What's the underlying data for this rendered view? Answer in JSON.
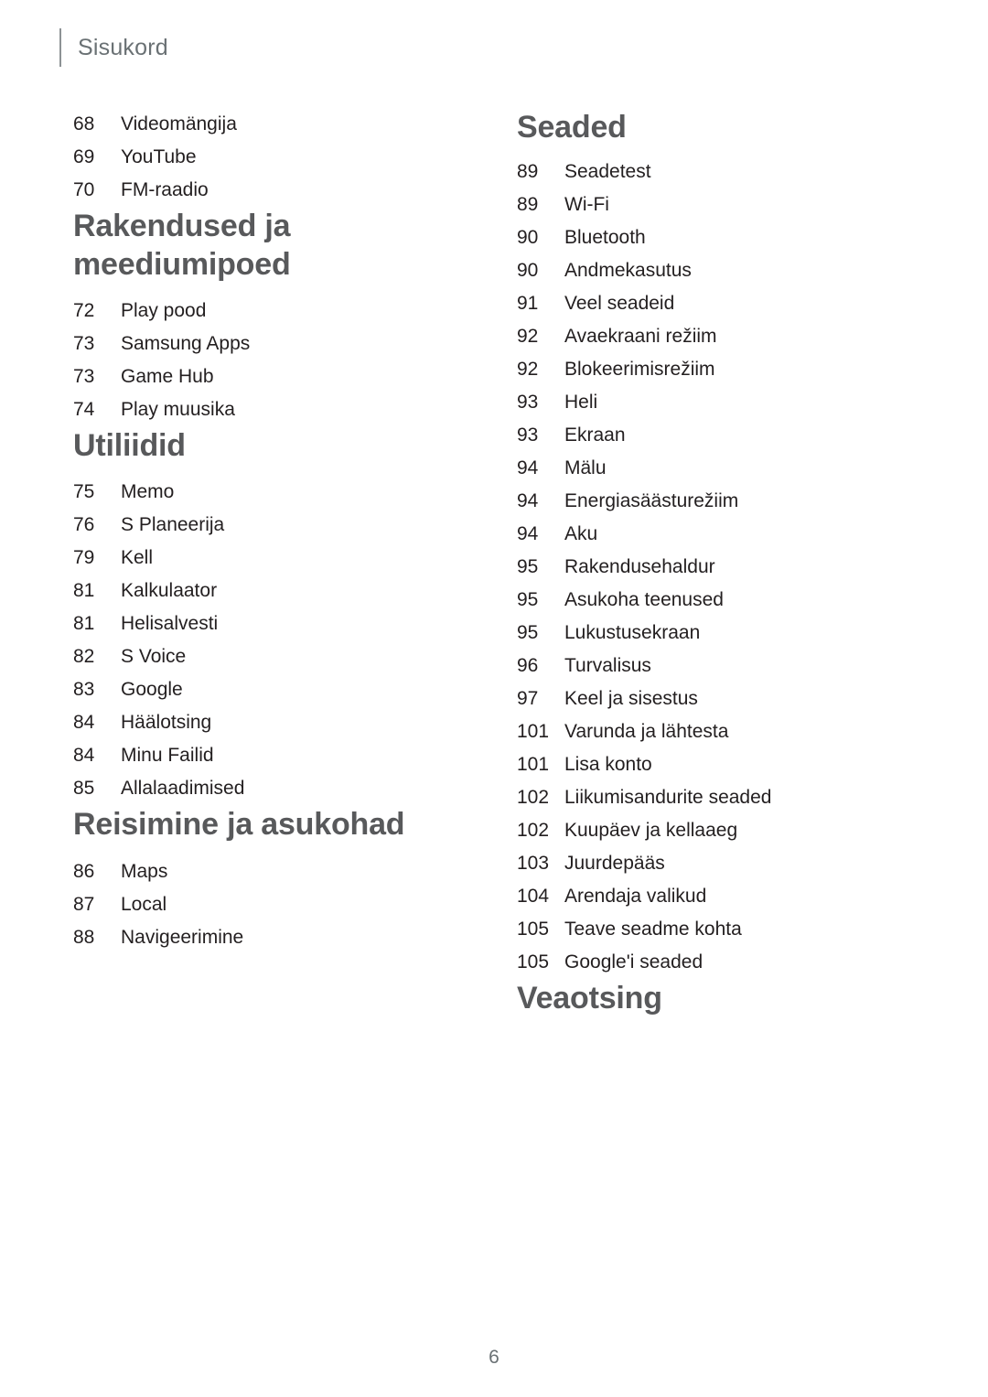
{
  "header": {
    "title": "Sisukord"
  },
  "folio": {
    "page_number": "6"
  },
  "colors": {
    "heading": "#58595b",
    "body_text": "#231f20",
    "running_header": "#6a7174",
    "rule": "#8d9295",
    "background": "#ffffff"
  },
  "left_column": {
    "sections": [
      {
        "heading": "",
        "entries": [
          {
            "page": "68",
            "label": "Videomängija"
          },
          {
            "page": "69",
            "label": "YouTube"
          },
          {
            "page": "70",
            "label": "FM-raadio"
          }
        ]
      },
      {
        "heading": "Rakendused ja\nmeediumipoed",
        "entries": [
          {
            "page": "72",
            "label": "Play pood"
          },
          {
            "page": "73",
            "label": "Samsung Apps"
          },
          {
            "page": "73",
            "label": "Game Hub"
          },
          {
            "page": "74",
            "label": "Play muusika"
          }
        ]
      },
      {
        "heading": "Utiliidid",
        "entries": [
          {
            "page": "75",
            "label": "Memo"
          },
          {
            "page": "76",
            "label": "S Planeerija"
          },
          {
            "page": "79",
            "label": "Kell"
          },
          {
            "page": "81",
            "label": "Kalkulaator"
          },
          {
            "page": "81",
            "label": "Helisalvesti"
          },
          {
            "page": "82",
            "label": "S Voice"
          },
          {
            "page": "83",
            "label": "Google"
          },
          {
            "page": "84",
            "label": "Häälotsing"
          },
          {
            "page": "84",
            "label": "Minu Failid"
          },
          {
            "page": "85",
            "label": "Allalaadimised"
          }
        ]
      },
      {
        "heading": "Reisimine ja asukohad",
        "entries": [
          {
            "page": "86",
            "label": "Maps"
          },
          {
            "page": "87",
            "label": "Local"
          },
          {
            "page": "88",
            "label": "Navigeerimine"
          }
        ]
      }
    ]
  },
  "right_column": {
    "sections": [
      {
        "heading": "Seaded",
        "entries": [
          {
            "page": "89",
            "label": "Seadetest"
          },
          {
            "page": "89",
            "label": "Wi-Fi"
          },
          {
            "page": "90",
            "label": "Bluetooth"
          },
          {
            "page": "90",
            "label": "Andmekasutus"
          },
          {
            "page": "91",
            "label": "Veel seadeid"
          },
          {
            "page": "92",
            "label": "Avaekraani režiim"
          },
          {
            "page": "92",
            "label": "Blokeerimisrežiim"
          },
          {
            "page": "93",
            "label": "Heli"
          },
          {
            "page": "93",
            "label": "Ekraan"
          },
          {
            "page": "94",
            "label": "Mälu"
          },
          {
            "page": "94",
            "label": "Energiasäästurežiim"
          },
          {
            "page": "94",
            "label": "Aku"
          },
          {
            "page": "95",
            "label": "Rakendusehaldur"
          },
          {
            "page": "95",
            "label": "Asukoha teenused"
          },
          {
            "page": "95",
            "label": "Lukustusekraan"
          },
          {
            "page": "96",
            "label": "Turvalisus"
          },
          {
            "page": "97",
            "label": "Keel ja sisestus"
          },
          {
            "page": "101",
            "label": "Varunda ja lähtesta"
          },
          {
            "page": "101",
            "label": "Lisa konto"
          },
          {
            "page": "102",
            "label": "Liikumisandurite seaded"
          },
          {
            "page": "102",
            "label": "Kuupäev ja kellaaeg"
          },
          {
            "page": "103",
            "label": "Juurdepääs"
          },
          {
            "page": "104",
            "label": "Arendaja valikud"
          },
          {
            "page": "105",
            "label": "Teave seadme kohta"
          },
          {
            "page": "105",
            "label": "Google'i seaded"
          }
        ]
      },
      {
        "heading": "Veaotsing",
        "entries": []
      }
    ]
  }
}
